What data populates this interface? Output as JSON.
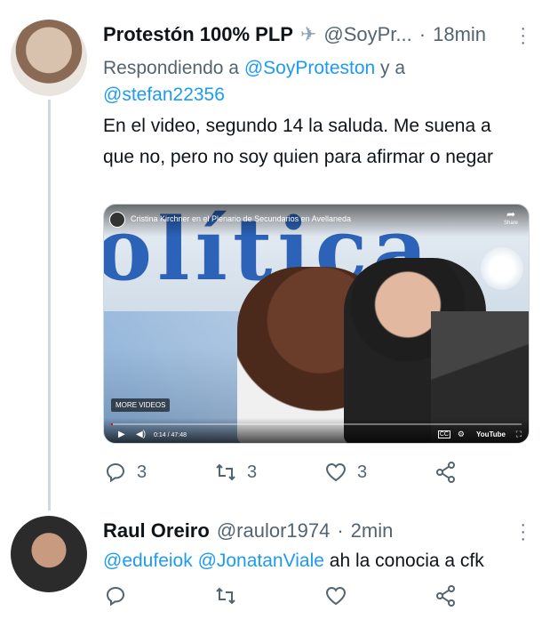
{
  "tweet1": {
    "display_name": "Protestón 100% PLP",
    "name_icon": "airplane-icon",
    "handle": "@SoyPr...",
    "dot": "·",
    "time": "18min",
    "replying_prefix": "Respondiendo a",
    "replying_mention_1": "@SoyProteston",
    "replying_and": "y a",
    "replying_mention_2": "@stefan22356",
    "text": "En el video, segundo 14 la saluda. Me suena a que no, pero no soy quien para afirmar o negar",
    "video": {
      "title": "Cristina Kirchner en el Plenario de Secundarios en Avellaneda",
      "banner_text": "olítica",
      "share_label": "Share",
      "more_videos": "MORE VIDEOS",
      "time": "0:14 / 47:48",
      "progress": 0.005,
      "cc_label": "CC",
      "logo": "YouTube"
    },
    "actions": {
      "reply_count": "3",
      "retweet_count": "3",
      "like_count": "3"
    }
  },
  "tweet2": {
    "display_name": "Raul Oreiro",
    "handle": "@raulor1974",
    "dot": "·",
    "time": "2min",
    "mention_1": "@edufeiok",
    "mention_2": "@JonatanViale",
    "text": "ah la conocia a cfk"
  },
  "colors": {
    "accent": "#1d9bf0",
    "muted": "#536471",
    "text": "#0f1419",
    "thread_line": "#cfd9de"
  }
}
